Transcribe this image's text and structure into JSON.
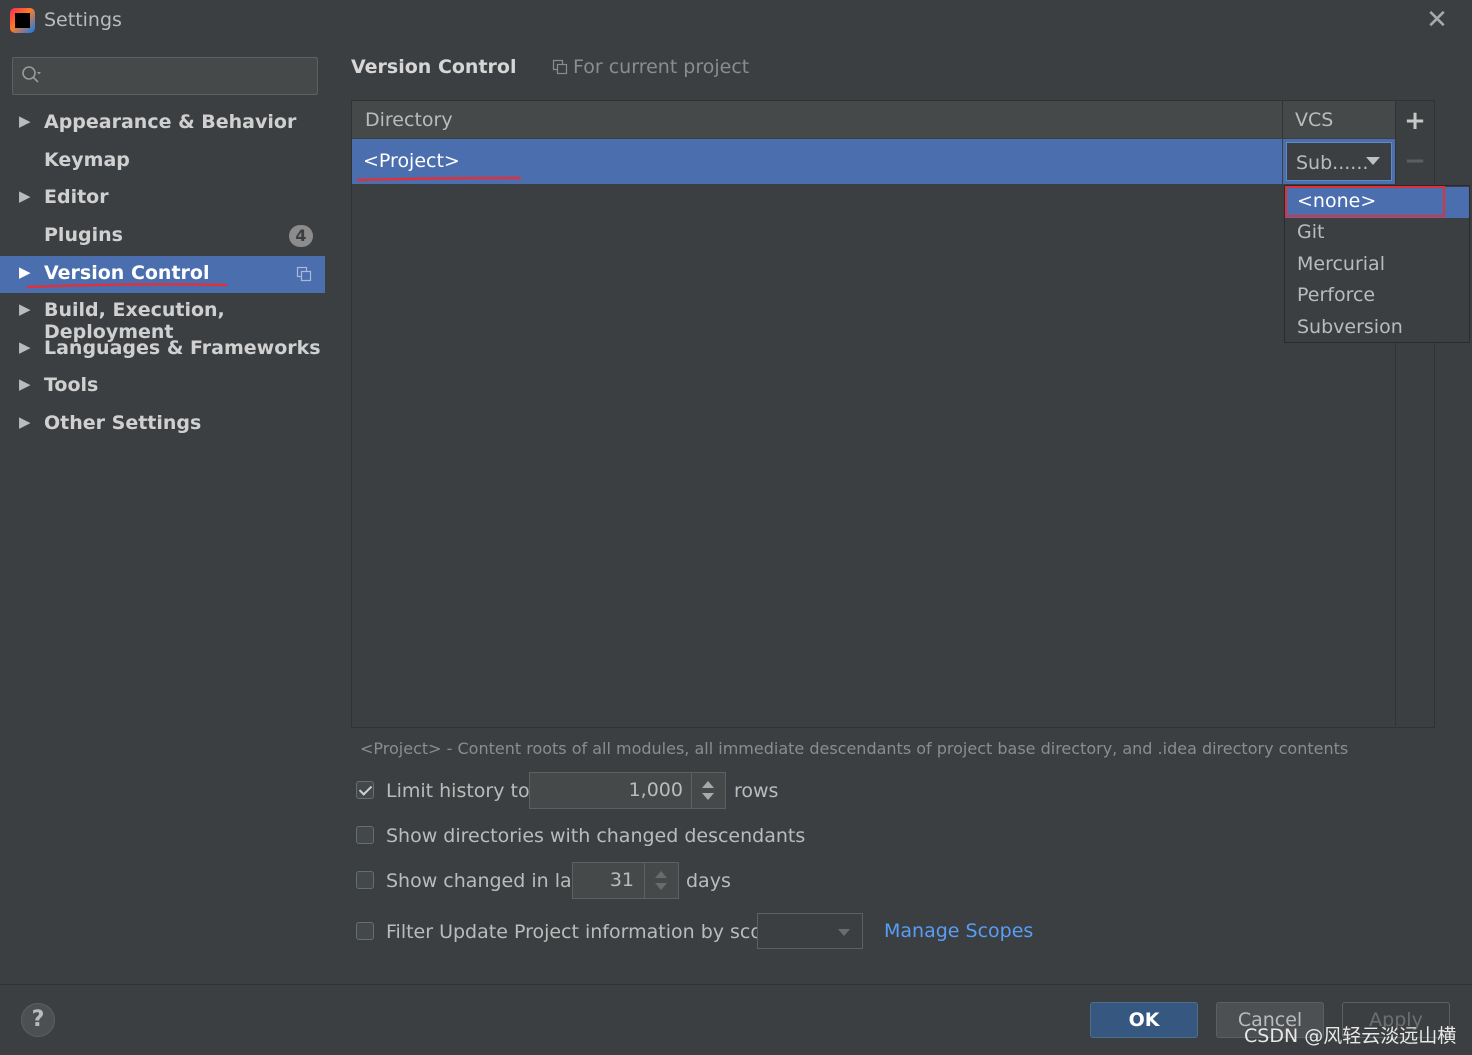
{
  "window": {
    "title": "Settings",
    "close_symbol": "✕"
  },
  "sidebar": {
    "search_placeholder": "",
    "items": [
      {
        "label": "Appearance & Behavior",
        "expandable": true
      },
      {
        "label": "Keymap",
        "expandable": false
      },
      {
        "label": "Editor",
        "expandable": true
      },
      {
        "label": "Plugins",
        "expandable": false,
        "badge": "4"
      },
      {
        "label": "Version Control",
        "expandable": true,
        "selected": true
      },
      {
        "label": "Build, Execution, Deployment",
        "expandable": true
      },
      {
        "label": "Languages & Frameworks",
        "expandable": true
      },
      {
        "label": "Tools",
        "expandable": true
      },
      {
        "label": "Other Settings",
        "expandable": true
      }
    ]
  },
  "main": {
    "title": "Version Control",
    "scope_label": "For current project",
    "table": {
      "headers": {
        "directory": "Directory",
        "vcs": "VCS"
      },
      "rows": [
        {
          "directory": "<Project>",
          "vcs": "Sub......"
        }
      ],
      "add_symbol": "+",
      "remove_symbol": "−"
    },
    "vcs_dropdown": {
      "options": [
        "<none>",
        "Git",
        "Mercurial",
        "Perforce",
        "Subversion"
      ],
      "highlighted": "<none>"
    },
    "hint": "<Project> - Content roots of all modules, all immediate descendants of project base directory, and .idea directory contents",
    "options": {
      "limit_history": {
        "label": "Limit history to:",
        "checked": true,
        "value": "1,000",
        "suffix": "rows"
      },
      "show_dirs": {
        "label": "Show directories with changed descendants",
        "checked": false
      },
      "show_changed": {
        "label": "Show changed in last",
        "checked": false,
        "value": "31",
        "suffix": "days"
      },
      "filter_update": {
        "label": "Filter Update Project information by scope",
        "checked": false,
        "scope_value": ""
      }
    },
    "manage_scopes_link": "Manage Scopes"
  },
  "footer": {
    "help": "?",
    "ok": "OK",
    "cancel": "Cancel",
    "apply": "Apply"
  },
  "watermark": "CSDN @风轻云淡远山横",
  "colors": {
    "background": "#3c3f41",
    "selection": "#4b6eaf",
    "link": "#589df6",
    "ok_button": "#365880",
    "annotation_red": "#e0303a"
  }
}
